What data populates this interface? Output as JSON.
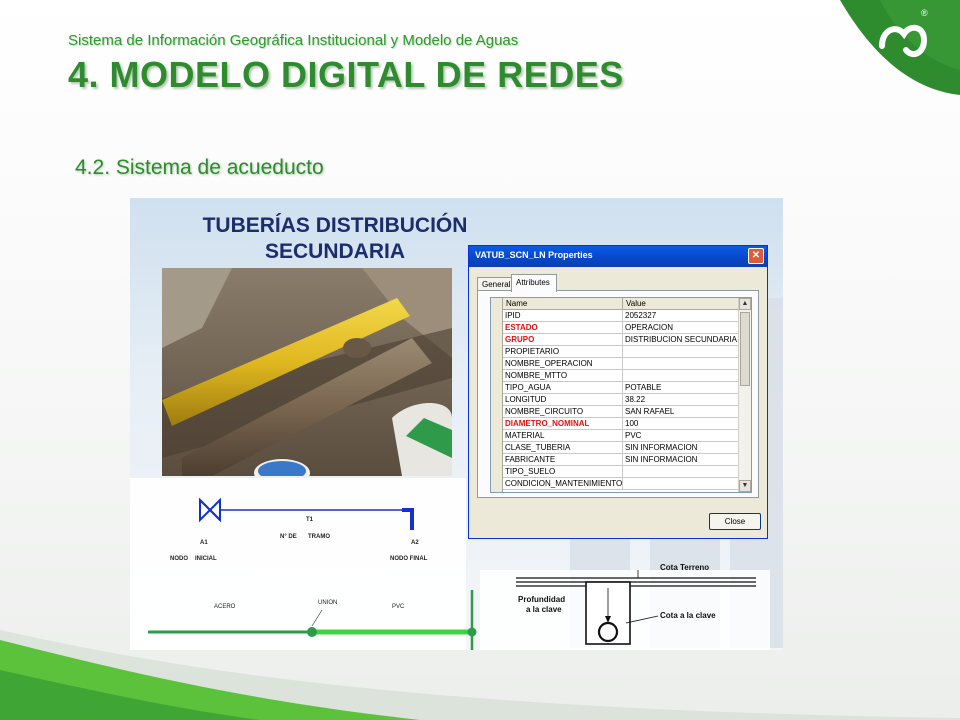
{
  "header": {
    "subtitle": "Sistema de Información Geográfica Institucional y Modelo de Aguas",
    "title": "4. MODELO DIGITAL DE REDES"
  },
  "section": {
    "title": "4.2. Sistema de acueducto"
  },
  "brand": {
    "logo_icon": "epm-logo-icon",
    "registered": "®",
    "color_primary": "#2e8b2e",
    "color_light": "#5cc23c"
  },
  "panel": {
    "title_line1": "TUBERÍAS DISTRIBUCIÓN",
    "title_line2": "SECUNDARIA",
    "title_color": "#1c2d6b"
  },
  "diagram": {
    "segment_label": "T1",
    "segment_caption_1": "N° DE",
    "segment_caption_2": "TRAMO",
    "node_start_id": "A1",
    "node_start_label_1": "NODO",
    "node_start_label_2": "INICIAL",
    "node_end_id": "A2",
    "node_end_label": "NODO FINAL",
    "pipe_left_label": "ACERO",
    "union_label": "UNION",
    "pipe_right_label": "PVC",
    "section_top_label": "Cota Terreno",
    "section_depth_label_1": "Profundidad",
    "section_depth_label_2": "a la clave",
    "section_crown_label": "Cota a la clave"
  },
  "dialog": {
    "title": "VATUB_SCN_LN Properties",
    "tabs": [
      {
        "label": "General",
        "active": false
      },
      {
        "label": "Attributes",
        "active": true
      }
    ],
    "columns": [
      "Name",
      "Value"
    ],
    "rows": [
      {
        "name": "IPID",
        "value": "2052327",
        "highlight": false
      },
      {
        "name": "ESTADO",
        "value": "OPERACION",
        "highlight": true
      },
      {
        "name": "GRUPO",
        "value": "DISTRIBUCION SECUNDARIA",
        "highlight": true
      },
      {
        "name": "PROPIETARIO",
        "value": "",
        "highlight": false
      },
      {
        "name": "NOMBRE_OPERACION",
        "value": "",
        "highlight": false
      },
      {
        "name": "NOMBRE_MTTO",
        "value": "",
        "highlight": false
      },
      {
        "name": "TIPO_AGUA",
        "value": "POTABLE",
        "highlight": false
      },
      {
        "name": "LONGITUD",
        "value": "38.22",
        "highlight": false
      },
      {
        "name": "NOMBRE_CIRCUITO",
        "value": "SAN RAFAEL",
        "highlight": false
      },
      {
        "name": "DIAMETRO_NOMINAL",
        "value": "100",
        "highlight": true
      },
      {
        "name": "MATERIAL",
        "value": "PVC",
        "highlight": false
      },
      {
        "name": "CLASE_TUBERIA",
        "value": "SIN INFORMACION",
        "highlight": false
      },
      {
        "name": "FABRICANTE",
        "value": "SIN INFORMACION",
        "highlight": false
      },
      {
        "name": "TIPO_SUELO",
        "value": "",
        "highlight": false
      },
      {
        "name": "CONDICION_MANTENIMIENTO",
        "value": "",
        "highlight": false
      }
    ],
    "close_label": "Close",
    "close_icon": "close-x-icon",
    "highlight_color": "#e01010",
    "titlebar_color": "#0a5ae6"
  }
}
